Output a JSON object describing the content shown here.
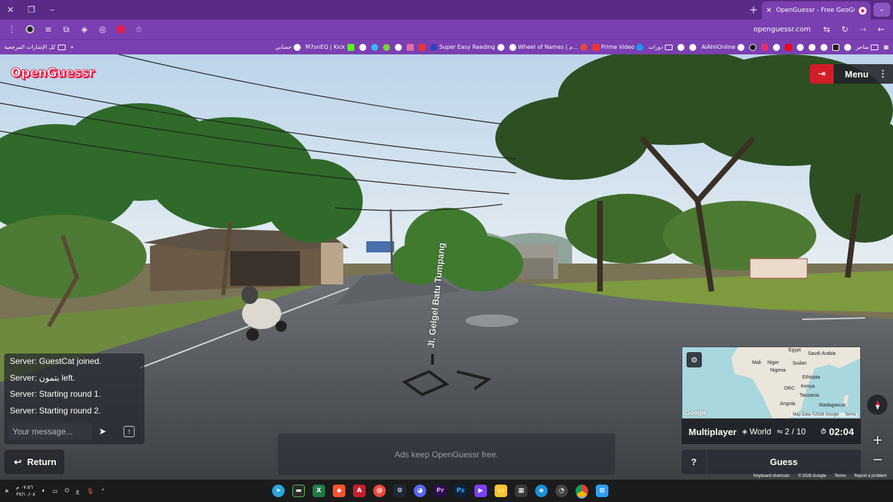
{
  "browser": {
    "active_tab_title": "OpenGuessr - Free GeoGuessr A",
    "url": "openguessr.com",
    "bookmarks_left": [
      {
        "label": "كل الإشارات المرجعية",
        "type": "folder"
      },
      {
        "label": "حسابي",
        "type": "site"
      },
      {
        "label": "M7snEQ | Kick",
        "type": "site"
      },
      {
        "label": "Super Easy Reading",
        "type": "site"
      },
      {
        "label": "Wheel of Names | م...",
        "type": "site"
      },
      {
        "label": "Prime Video",
        "type": "site"
      },
      {
        "label": "دورات",
        "type": "folder"
      },
      {
        "label": "AlAhliOnline",
        "type": "site"
      },
      {
        "label": "متاجر",
        "type": "folder"
      }
    ]
  },
  "game": {
    "logo": "OpenGuessr",
    "menu_label": "Menu",
    "road_label": "Jl. Gelgel Batu Tumpang",
    "chat": {
      "messages": [
        "Server: GuestCat joined.",
        "Server: بتمون left.",
        "Server: Starting round 1.",
        "Server: Starting round 2."
      ],
      "placeholder": "Your message..."
    },
    "return_label": "Return",
    "ads_text": "Ads keep OpenGuessr free.",
    "map": {
      "labels": [
        "Mali",
        "Niger",
        "Egypt",
        "Saudi Arabia",
        "Sudan",
        "Nigeria",
        "Ethiopia",
        "DRC",
        "Kenya",
        "Tanzania",
        "Angola",
        "Madagascar"
      ],
      "attribution": "Map Data ©2026 Google",
      "terms": "Terms",
      "google": "Google"
    },
    "info": {
      "mode": "Multiplayer",
      "region": "World",
      "round": "2 / 10",
      "timer": "02:04"
    },
    "help_label": "?",
    "guess_label": "Guess",
    "footer": [
      "Keyboard shortcuts",
      "© 2026 Google",
      "Terms",
      "Report a problem"
    ]
  },
  "taskbar": {
    "time": "٠٧:٥٦ م",
    "date": "٢٧/١٠/٠٨",
    "lang": "ع"
  },
  "colors": {
    "chrome_dark": "#5b2a86",
    "chrome": "#7a3fb0",
    "leave_red": "#d11d28",
    "logo_red": "#e3204a"
  }
}
